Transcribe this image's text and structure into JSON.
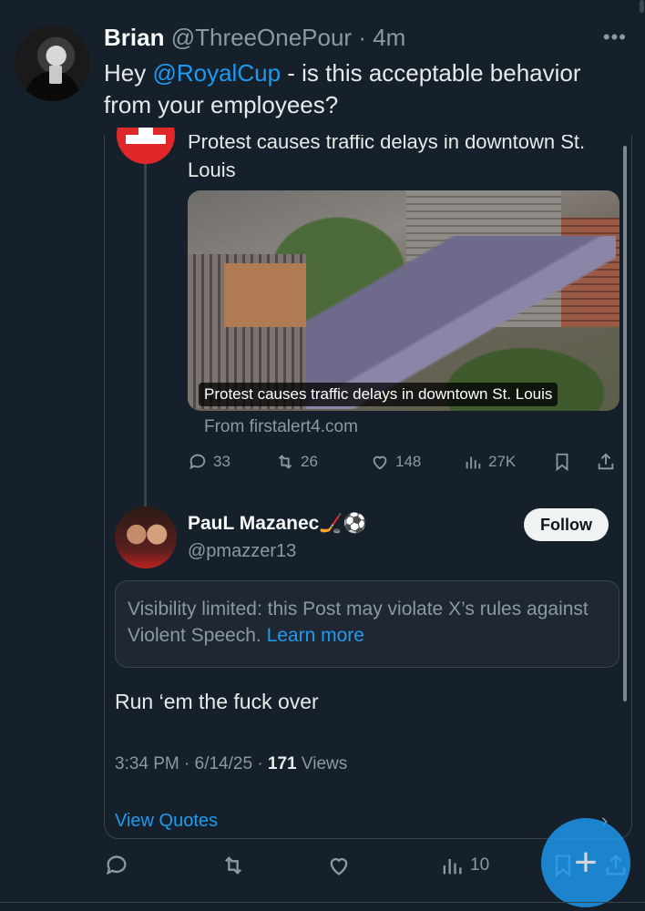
{
  "tweet": {
    "author_name": "Brian",
    "author_handle": "@ThreeOnePour",
    "time": "· 4m",
    "more_icon": "more-dots-icon",
    "text_before_mention": "Hey ",
    "mention": "@RoyalCup",
    "text_after_mention": " - is this acceptable behavior from your employees?"
  },
  "quoted": {
    "parent_text": "Protest causes traffic delays in downtown St. Louis",
    "media_caption": "Protest causes traffic delays in downtown St. Louis",
    "from": "From firstalert4.com",
    "actions": {
      "replies": "33",
      "reposts": "26",
      "likes": "148",
      "views": "27K"
    },
    "reply": {
      "name": "PauL Mazanec",
      "name_emoji": "🏒⚽",
      "handle": "@pmazzer13",
      "follow_label": "Follow",
      "visibility_text": "Visibility limited: this Post may violate X’s rules against Violent Speech.",
      "learn_more": "Learn more",
      "text": "Run ‘em the fuck over",
      "time": "3:34 PM · 6/14/25 · ",
      "views_count": "171",
      "views_label": " Views",
      "view_quotes": "View Quotes"
    }
  },
  "bottom_actions": {
    "views": "10"
  },
  "colors": {
    "background": "#15202b",
    "accent": "#1d9bf0",
    "muted": "#8b98a5",
    "border": "#38444d"
  }
}
